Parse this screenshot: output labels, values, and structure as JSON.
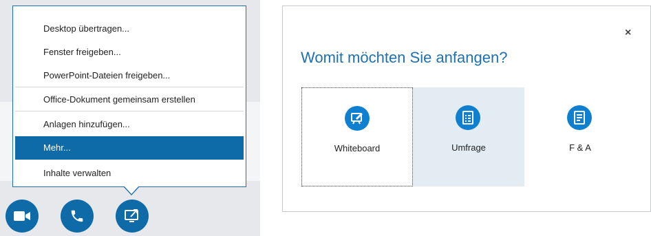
{
  "menu": {
    "items": [
      {
        "label": "Desktop übertragen..."
      },
      {
        "label": "Fenster freigeben..."
      },
      {
        "label": "PowerPoint-Dateien freigeben..."
      },
      {
        "label": "Office-Dokument gemeinsam erstellen"
      },
      {
        "label": "Anlagen hinzufügen..."
      },
      {
        "label": "Mehr...",
        "selected": true
      },
      {
        "label": "Inhalte verwalten"
      }
    ]
  },
  "toolbar": {
    "buttons": [
      {
        "icon": "video-camera-icon"
      },
      {
        "icon": "phone-icon"
      },
      {
        "icon": "share-screen-icon"
      }
    ]
  },
  "dialog": {
    "title": "Womit möchten Sie anfangen?",
    "close_label": "×",
    "options": [
      {
        "label": "Whiteboard",
        "icon": "whiteboard-icon"
      },
      {
        "label": "Umfrage",
        "icon": "poll-icon"
      },
      {
        "label": "F & A",
        "icon": "qa-icon"
      }
    ]
  },
  "colors": {
    "accent": "#0f6aa8",
    "title_blue": "#1f6fb3",
    "option_highlight": "#e3ecf3"
  }
}
